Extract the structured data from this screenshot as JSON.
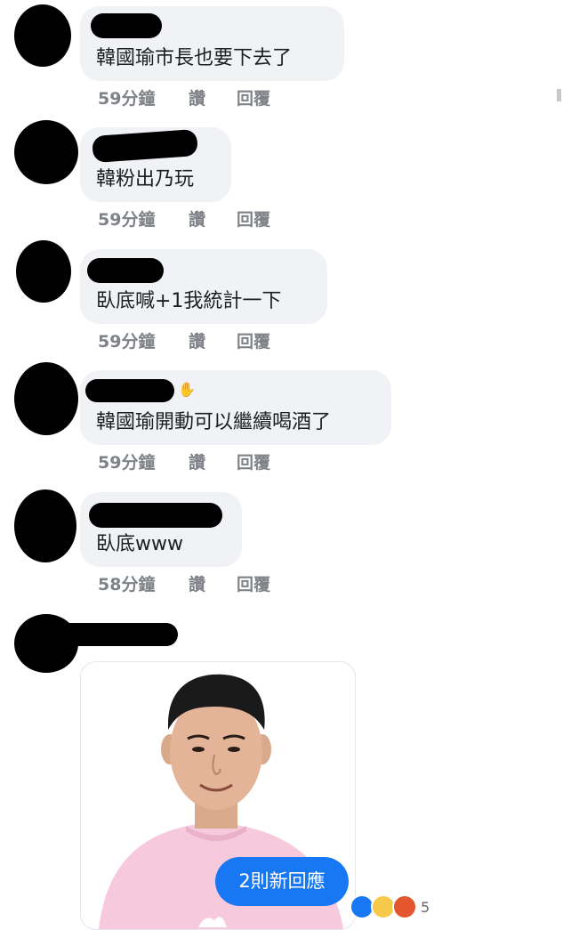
{
  "comments": [
    {
      "text": "韓國瑜市長也要下去了",
      "time": "59分鐘",
      "like": "讚",
      "reply": "回覆"
    },
    {
      "text": "韓粉出乃玩",
      "time": "59分鐘",
      "like": "讚",
      "reply": "回覆"
    },
    {
      "text": "臥底喊+1我統計一下",
      "time": "59分鐘",
      "like": "讚",
      "reply": "回覆"
    },
    {
      "text": "韓國瑜開動可以繼續喝酒了",
      "time": "59分鐘",
      "like": "讚",
      "reply": "回覆"
    },
    {
      "text": "臥底www",
      "time": "58分鐘",
      "like": "讚",
      "reply": "回覆"
    }
  ],
  "new_replies": "2則新回應",
  "reaction_count": "5",
  "colors": {
    "bubble": "#f0f2f5",
    "meta_text": "#7f8287",
    "accent": "#1877f2",
    "photo_shirt": "#f6c9dc"
  },
  "icons": [
    "like-reaction-icon",
    "haha-reaction-icon",
    "angry-reaction-icon",
    "wave-icon"
  ]
}
